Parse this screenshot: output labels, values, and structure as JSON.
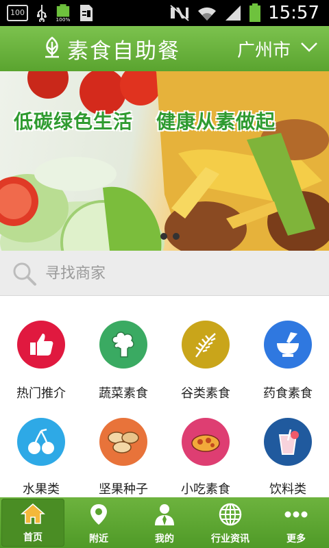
{
  "statusbar": {
    "time": "15:57",
    "notif_badge": "100",
    "battery_percent_label": "100%"
  },
  "header": {
    "title": "素食自助餐",
    "city": "广州市"
  },
  "banner": {
    "slogan_left": "低碳绿色生活",
    "slogan_right": "健康从素做起",
    "page_count": 2,
    "active_page": 1
  },
  "search": {
    "placeholder": "寻找商家"
  },
  "categories": [
    {
      "label": "热门推介",
      "color": "#e0193f",
      "icon": "thumbs-up-icon"
    },
    {
      "label": "蔬菜素食",
      "color": "#3aaa62",
      "icon": "broccoli-icon"
    },
    {
      "label": "谷类素食",
      "color": "#c9a51a",
      "icon": "grain-icon"
    },
    {
      "label": "药食素食",
      "color": "#2f78e0",
      "icon": "mortar-pestle-icon"
    },
    {
      "label": "水果类",
      "color": "#2ea9e6",
      "icon": "cherry-icon"
    },
    {
      "label": "坚果种子",
      "color": "#e8733a",
      "icon": "nuts-icon"
    },
    {
      "label": "小吃素食",
      "color": "#de3e72",
      "icon": "snack-icon"
    },
    {
      "label": "饮料类",
      "color": "#205a9e",
      "icon": "drink-icon"
    }
  ],
  "bottomnav": [
    {
      "label": "首页",
      "icon": "home-icon",
      "active": true
    },
    {
      "label": "附近",
      "icon": "location-pin-icon",
      "active": false
    },
    {
      "label": "我的",
      "icon": "user-icon",
      "active": false
    },
    {
      "label": "行业资讯",
      "icon": "globe-icon",
      "active": false
    },
    {
      "label": "更多",
      "icon": "more-dots-icon",
      "active": false
    }
  ],
  "colors": {
    "brand_green": "#5aa42f",
    "banner_text_green": "#2f9b30"
  }
}
